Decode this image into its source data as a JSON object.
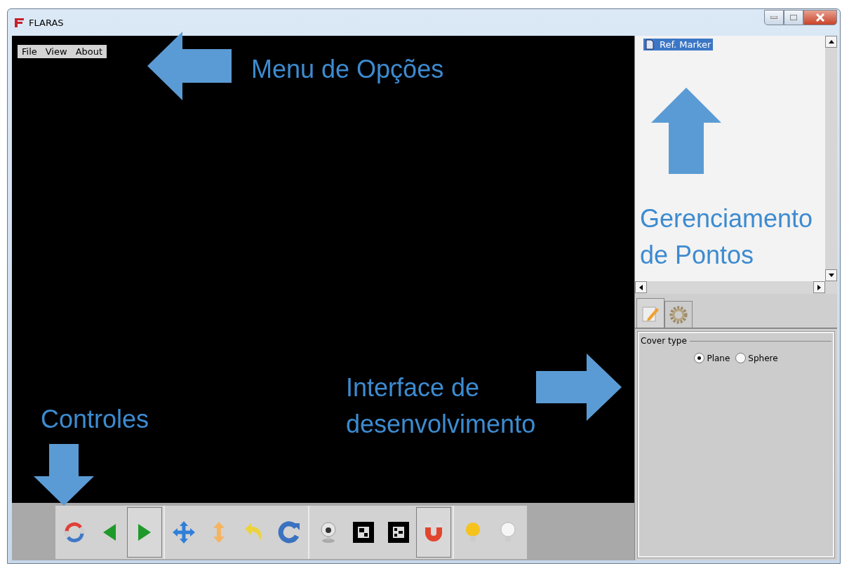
{
  "window": {
    "title": "FLARAS"
  },
  "menu": [
    "File",
    "View",
    "About"
  ],
  "toolbar": {
    "groups": [
      [
        {
          "kind": "reset",
          "selected": false
        },
        {
          "kind": "prev",
          "selected": false
        },
        {
          "kind": "next",
          "selected": true
        }
      ],
      [
        {
          "kind": "move",
          "selected": false
        },
        {
          "kind": "scale",
          "selected": false
        },
        {
          "kind": "undo",
          "selected": false
        },
        {
          "kind": "redo",
          "selected": false
        }
      ],
      [
        {
          "kind": "webcam",
          "selected": false
        },
        {
          "kind": "marker-a",
          "selected": false
        },
        {
          "kind": "marker-b",
          "selected": false
        },
        {
          "kind": "magnet",
          "selected": true
        }
      ],
      [
        {
          "kind": "light-on",
          "selected": false
        },
        {
          "kind": "light-off",
          "selected": false
        }
      ]
    ]
  },
  "tree": {
    "items": [
      {
        "label": "Ref. Marker",
        "selected": true
      }
    ]
  },
  "tabs": [
    {
      "kind": "edit",
      "selected": true
    },
    {
      "kind": "settings",
      "selected": false
    }
  ],
  "cover_type": {
    "title": "Cover type",
    "options": [
      {
        "label": "Plane",
        "selected": true
      },
      {
        "label": "Sphere",
        "selected": false
      }
    ]
  },
  "annotations": [
    {
      "kind": "left"
    },
    {
      "kind": "label",
      "text": "Menu de Opções"
    },
    {
      "kind": "up"
    },
    {
      "kind": "label",
      "text": "Gerenciamento de Pontos"
    },
    {
      "kind": "label",
      "text": "Controles"
    },
    {
      "kind": "label",
      "text": "Interface de desenvolvimento"
    },
    {
      "kind": "right"
    },
    {
      "kind": "down"
    }
  ]
}
